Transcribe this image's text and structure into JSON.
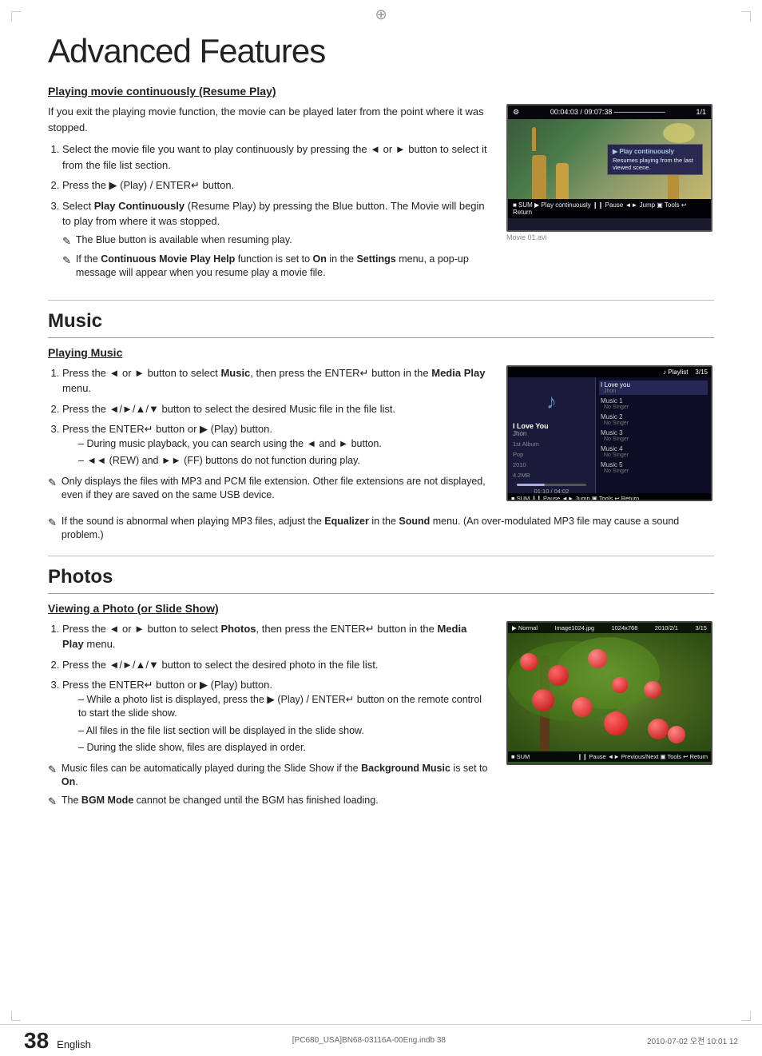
{
  "page": {
    "title": "Advanced Features",
    "footer": {
      "filename": "[PC680_USA]BN68-03116A-00Eng.indb   38",
      "date": "2010-07-02   오전 10:01   12",
      "page_number": "38",
      "page_label": "English"
    }
  },
  "sections": {
    "resume_play": {
      "heading": "Playing movie continuously (Resume Play)",
      "intro": "If you exit the playing movie function, the movie can be played later from the point where it was stopped.",
      "steps": [
        "Select the movie file you want to play continuously by pressing the ◄ or ► button to select it from the file list section.",
        "Press the ▶ (Play) / ENTER↵ button.",
        "Select Play Continuously (Resume Play) by pressing the Blue button. The Movie will begin to play from where it was stopped."
      ],
      "notes": [
        "The Blue button is available when resuming play.",
        "If the Continuous Movie Play Help function is set to On in the Settings menu, a pop-up message will appear when you resume play a movie file."
      ],
      "screen": {
        "top_bar": "00:04:03 / 09:07:38 ─────────────────── 1/1",
        "filename": "Movie 01.avi",
        "popup_title": "▶ Play continuously",
        "popup_text": "Resumes playing from the last viewed scene.",
        "bottom_bar": "■ SUM    ▶ Play continuously  ❙❙ Pause  ◄► Jump  ▣ Tools  ↩ Return"
      }
    },
    "music": {
      "section_title": "Music",
      "heading": "Playing Music",
      "steps": [
        "Press the ◄ or ► button to select Music, then press the ENTER↵ button in the Media Play menu.",
        "Press the ◄/►/▲/▼ button to select the desired Music file in the file list.",
        "Press the ENTER↵ button or ▶ (Play) button."
      ],
      "dash_items": [
        "During music playback, you can search using the ◄ and ► button.",
        "◄◄ (REW) and ►► (FF) buttons do not function during play."
      ],
      "notes": [
        "Only displays the files with MP3 and PCM file extension. Other file extensions are not displayed, even if they are saved on the same USB device.",
        "If the sound is abnormal when playing MP3 files, adjust the Equalizer in the Sound menu. (An over-modulated MP3 file may cause a sound problem.)"
      ],
      "screen": {
        "playlist_header": "♪ Playlist   3/15",
        "song_title": "I Love You",
        "artist": "Jhon",
        "album": "1st Album",
        "genre": "Pop",
        "year": "2010",
        "size": "4.2MB",
        "time": "01:10 / 04:02",
        "playlist": [
          {
            "title": "I Love you",
            "singer": "Jhon"
          },
          {
            "title": "Music 1",
            "singer": "No Singer"
          },
          {
            "title": "Music 2",
            "singer": "No Singer"
          },
          {
            "title": "Music 3",
            "singer": "No Singer"
          },
          {
            "title": "Music 4",
            "singer": "No Singer"
          },
          {
            "title": "Music 5",
            "singer": "No Singer"
          }
        ],
        "bottom_bar": "■ SUM    ❙❙ Pause  ◄► Jump  ▣ Tools  ↩ Return"
      }
    },
    "photos": {
      "section_title": "Photos",
      "heading": "Viewing a Photo (or Slide Show)",
      "steps": [
        "Press the ◄ or ► button to select Photos, then press the ENTER↵ button in the Media Play menu.",
        "Press the ◄/►/▲/▼ button to select the desired photo in the file list.",
        "Press the ENTER↵ button or ▶ (Play) button."
      ],
      "dash_items": [
        "While a photo list is displayed, press the ▶ (Play) / ENTER↵ button on the remote control to start the slide show.",
        "All files in the file list section will be displayed in the slide show.",
        "During the slide show, files are displayed in order."
      ],
      "notes": [
        "Music files can be automatically played during the Slide Show if the Background Music is set to On.",
        "The BGM Mode cannot be changed until the BGM has finished loading."
      ],
      "screen": {
        "top_bar": "▶ Normal   Image1024.jpg   1024x768   2010/2/1   3/15",
        "bottom_bar": "■ SUM    ❙❙ Pause  ◄► Previous/Next  ▣ Tools  ↩ Return"
      }
    }
  }
}
